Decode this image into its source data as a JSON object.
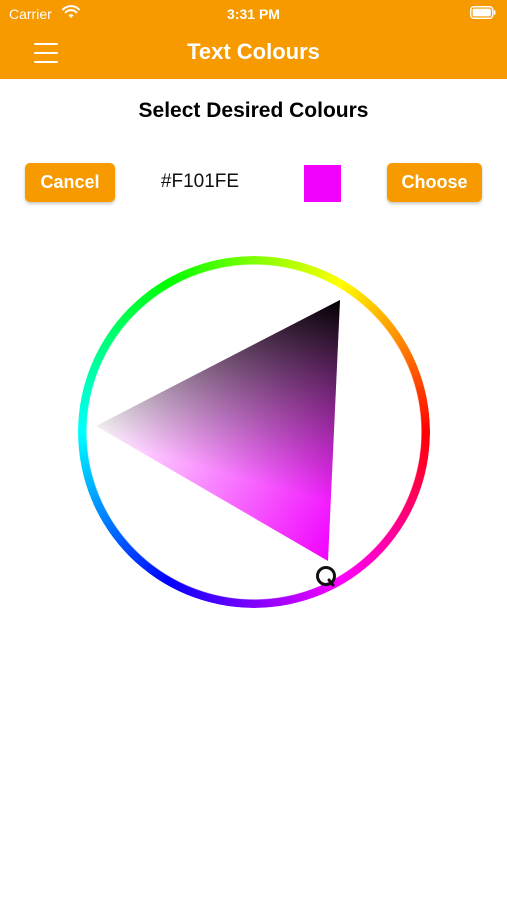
{
  "status_bar": {
    "carrier": "Carrier",
    "time": "3:31 PM",
    "icons": [
      "wifi-icon",
      "battery-icon"
    ]
  },
  "nav": {
    "title": "Text Colours",
    "menu_icon": "hamburger-menu-icon"
  },
  "content": {
    "heading": "Select Desired Colours",
    "cancel_label": "Cancel",
    "choose_label": "Choose",
    "hex_value": "#F101FE",
    "selected_color": "#F101FE"
  },
  "picker": {
    "type": "hue-ring-with-saturation-value-triangle",
    "hue_color": "#F101FE"
  },
  "colors": {
    "accent": "#F79A00",
    "background": "#FFFFFF"
  }
}
